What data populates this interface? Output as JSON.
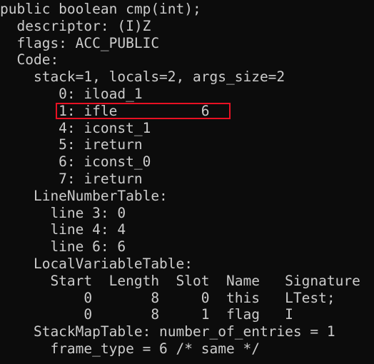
{
  "terminal": {
    "lines": [
      "public boolean cmp(int);",
      "  descriptor: (I)Z",
      "  flags: ACC_PUBLIC",
      "  Code:",
      "    stack=1, locals=2, args_size=2",
      "       0: iload_1",
      "       1: ifle          6",
      "       4: iconst_1",
      "       5: ireturn",
      "       6: iconst_0",
      "       7: ireturn",
      "    LineNumberTable:",
      "      line 3: 0",
      "      line 4: 4",
      "      line 6: 6",
      "    LocalVariableTable:",
      "      Start  Length  Slot  Name   Signature",
      "          0       8     0  this   LTest;",
      "          0       8     1  flag   I",
      "    StackMapTable: number_of_entries = 1",
      "      frame_type = 6 /* same */"
    ],
    "highlight_color": "#e81123",
    "text_color": "#cccccc",
    "background_color": "#0c0c0c"
  }
}
